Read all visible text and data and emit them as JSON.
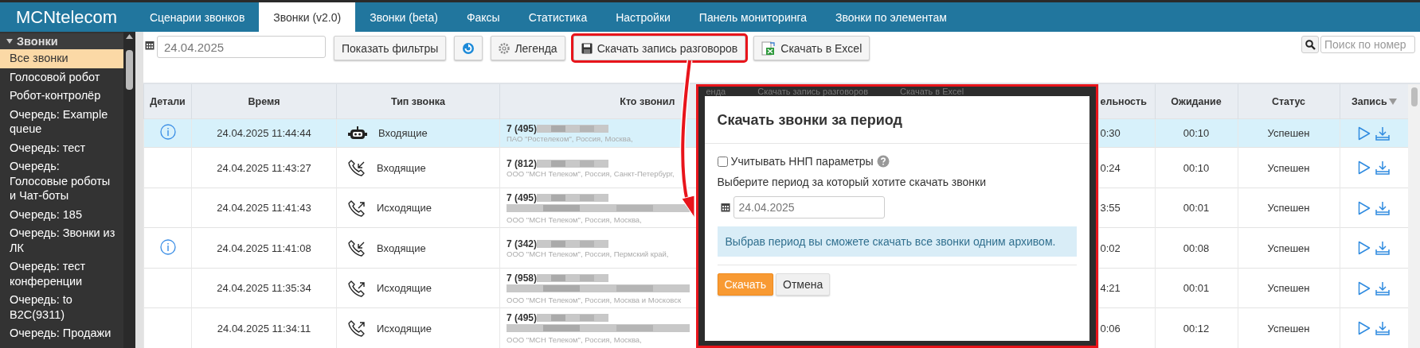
{
  "app": {
    "logo": "MCNtelecom"
  },
  "nav_tabs": [
    {
      "label": "Сценарии звонков",
      "selected": false
    },
    {
      "label": "Звонки (v2.0)",
      "selected": true
    },
    {
      "label": "Звонки (beta)",
      "selected": false
    },
    {
      "label": "Факсы",
      "selected": false
    },
    {
      "label": "Статистика",
      "selected": false
    },
    {
      "label": "Настройки",
      "selected": false
    },
    {
      "label": "Панель мониторинга",
      "selected": false
    },
    {
      "label": "Звонки по элементам",
      "selected": false
    }
  ],
  "sidebar": {
    "section": {
      "label": "Звонки",
      "expanded": true
    },
    "items": [
      {
        "label": "Все звонки",
        "selected": true
      },
      {
        "label": "Голосовой робот",
        "selected": false
      },
      {
        "label": "Робот-контролёр",
        "selected": false
      },
      {
        "label": "Очередь: Example queue",
        "selected": false
      },
      {
        "label": "Очередь: тест",
        "selected": false
      },
      {
        "label": "Очередь: Голосовые роботы и Чат-боты",
        "selected": false
      },
      {
        "label": "Очередь: 185",
        "selected": false
      },
      {
        "label": "Очередь: Звонки из ЛК",
        "selected": false
      },
      {
        "label": "Очередь: тест конференции",
        "selected": false
      },
      {
        "label": "Очередь: to B2C(9311)",
        "selected": false
      },
      {
        "label": "Очередь: Продажи",
        "selected": false
      }
    ]
  },
  "toolbar": {
    "date_field": {
      "value": "24.04.2025"
    },
    "buttons": [
      {
        "kind": "text",
        "label": "Показать фильтры",
        "highlighted": false
      },
      {
        "kind": "refresh",
        "highlighted": false
      },
      {
        "kind": "legend",
        "label": "Легенда",
        "highlighted": false
      },
      {
        "kind": "record",
        "label": "Скачать запись разговоров",
        "highlighted": true
      },
      {
        "kind": "excel",
        "label": "Скачать в Excel",
        "highlighted": false
      }
    ],
    "search": {
      "placeholder": "Поиск по номер"
    }
  },
  "table": {
    "left_columns": [
      "Детали",
      "Время",
      "Тип звонка",
      "Кто звонил"
    ],
    "right_columns": [
      "ельность",
      "Ожидание",
      "Статус",
      "Запись"
    ],
    "rows": [
      {
        "selected": true,
        "info": true,
        "time": "24.04.2025 11:44:44",
        "kind": "robot",
        "type_label": "Входящие",
        "number": "7 (495)",
        "extra_line": false,
        "operator": "ПАО \"Ростелеком\", Россия, Москва,",
        "duration": "0:30",
        "wait": "00:10",
        "status": "Успешен"
      },
      {
        "selected": false,
        "info": false,
        "time": "24.04.2025 11:43:27",
        "kind": "incoming",
        "type_label": "Входящие",
        "number": "7 (812)",
        "extra_line": false,
        "operator": "ООО \"МСН Телеком\", Россия, Санкт-Петербург,",
        "duration": "0:24",
        "wait": "00:10",
        "status": "Успешен"
      },
      {
        "selected": false,
        "info": false,
        "time": "24.04.2025 11:41:43",
        "kind": "outgoing",
        "type_label": "Исходящие",
        "number": "7 (495)",
        "extra_line": true,
        "operator": "ООО \"МСН Телеком\", Россия, Москва,",
        "duration": "3:55",
        "wait": "00:01",
        "status": "Успешен"
      },
      {
        "selected": false,
        "info": true,
        "time": "24.04.2025 11:41:08",
        "kind": "incoming",
        "type_label": "Входящие",
        "number": "7 (342)",
        "extra_line": false,
        "operator": "ООО \"МСН Телеком\", Россия, Пермский край,",
        "duration": "0:02",
        "wait": "00:08",
        "status": "Успешен"
      },
      {
        "selected": false,
        "info": false,
        "time": "24.04.2025 11:35:34",
        "kind": "outgoing",
        "type_label": "Исходящие",
        "number": "7 (958)",
        "extra_line": true,
        "operator": "ООО \"МСН Телеком\", Россия, Москва и Московск",
        "duration": "4:21",
        "wait": "00:01",
        "status": "Успешен"
      },
      {
        "selected": false,
        "info": false,
        "time": "24.04.2025 11:34:11",
        "kind": "outgoing",
        "type_label": "Исходящие",
        "number": "7 (495)",
        "extra_line": true,
        "operator": "ООО \"МСН Телеком\", Россия, Москва,",
        "duration": "0:06",
        "wait": "00:12",
        "status": "Успешен"
      }
    ]
  },
  "modal": {
    "backdrop_texts": [
      "енда",
      "Скачать запись разговоров",
      "Скачать в Excel"
    ],
    "title": "Скачать звонки за период",
    "checkbox": {
      "label": "Учитывать ННП параметры",
      "checked": false
    },
    "period_label": "Выберите период за который хотите скачать звонки",
    "date_field": {
      "value": "24.04.2025"
    },
    "info": "Выбрав период вы сможете скачать все звонки одним архивом.",
    "buttons": [
      {
        "label": "Скачать",
        "kind": "primary"
      },
      {
        "label": "Отмена",
        "kind": "default"
      }
    ]
  }
}
